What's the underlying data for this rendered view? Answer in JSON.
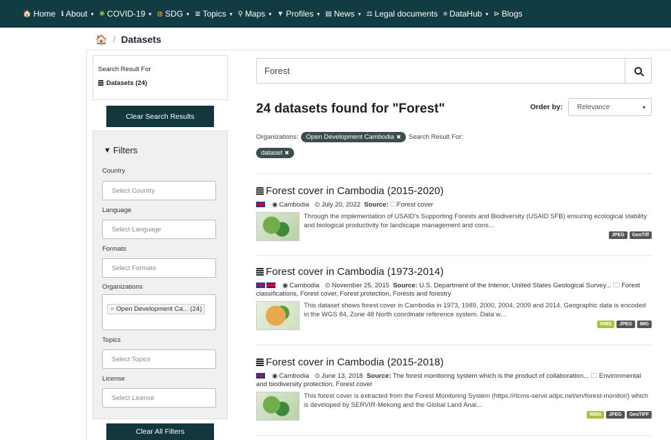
{
  "nav": {
    "items": [
      {
        "icon": "home-icon",
        "glyph": "🏠",
        "label": "Home",
        "caret": false
      },
      {
        "icon": "info-icon",
        "glyph": "ℹ",
        "label": "About",
        "caret": true
      },
      {
        "icon": "virus-icon",
        "glyph": "✺",
        "label": "COVID-19",
        "caret": true
      },
      {
        "icon": "sdg-icon",
        "glyph": "◍",
        "label": "SDG",
        "caret": true
      },
      {
        "icon": "list-icon",
        "glyph": "≣",
        "label": "Topics",
        "caret": true
      },
      {
        "icon": "map-marker-icon",
        "glyph": "⚲",
        "label": "Maps",
        "caret": true
      },
      {
        "icon": "filter-icon",
        "glyph": "▼",
        "label": "Profiles",
        "caret": true
      },
      {
        "icon": "newspaper-icon",
        "glyph": "▤",
        "label": "News",
        "caret": true
      },
      {
        "icon": "gavel-icon",
        "glyph": "⚖",
        "label": "Legal documents",
        "caret": false
      },
      {
        "icon": "database-icon",
        "glyph": "≡",
        "label": "DataHub",
        "caret": true
      },
      {
        "icon": "rss-icon",
        "glyph": "⊳",
        "label": "Blogs",
        "caret": false
      }
    ]
  },
  "breadcrumb": {
    "home_glyph": "🏠",
    "separator": "/",
    "current": "Datasets"
  },
  "result_box": {
    "title": "Search Result For",
    "datasets": "Datasets (24)"
  },
  "buttons": {
    "clear_search": "Clear Search Results",
    "clear_filters": "Clear All Filters"
  },
  "filters": {
    "title": "Filters",
    "country": {
      "label": "Country",
      "placeholder": "Select Country"
    },
    "language": {
      "label": "Language",
      "placeholder": "Select Language"
    },
    "formats": {
      "label": "Formats",
      "placeholder": "Select Formats"
    },
    "organizations": {
      "label": "Organizations",
      "chip": "Open Development Ca... (24)"
    },
    "topics": {
      "label": "Topics",
      "placeholder": "Select Topics"
    },
    "license": {
      "label": "License",
      "placeholder": "Select License"
    }
  },
  "search": {
    "value": "Forest"
  },
  "found_text": "24 datasets found for \"Forest\"",
  "order": {
    "label": "Order by:",
    "selected": "Relevance"
  },
  "facets": {
    "org_label": "Organizations:",
    "org_chip": "Open Development Cambodia",
    "result_label": "Search Result For:",
    "type_chip": "dataset"
  },
  "datasets": [
    {
      "title": "Forest cover in Cambodia (2015-2020)",
      "country": "Cambodia",
      "date": "July 20, 2022",
      "source_label": "Source:",
      "source": "Forest cover",
      "description": "Through the implementation of USAID's Supporting Forests and Biodiversity (USAID SFB) ensuring ecological stability and biological productivity for landscape management and cons...",
      "formats": [
        "JPEG",
        "GeoTiff"
      ]
    },
    {
      "title": "Forest cover in Cambodia (1973-2014)",
      "country": "Cambodia",
      "date": "November 25, 2015",
      "source_label": "Source:",
      "source": "U.S. Department of the Interior, United States Geological Survey... 🗀 Forest classifications, Forest cover, Forest protection, Forests and forestry",
      "description": "This dataset shows forest cover in Cambodia in 1973, 1989, 2000, 2004, 2009 and 2014. Geographic data is encoded in the WGS 84, Zone 48 North coordinate reference system. Data w...",
      "formats": [
        "WMS",
        "JPEG",
        "IMG"
      ]
    },
    {
      "title": "Forest cover in Cambodia (2015-2018)",
      "country": "Cambodia",
      "date": "June 13, 2018",
      "source_label": "Source:",
      "source": "The forest monitoring system which is the product of collaboration... 🗀 Environmental and biodiversity protection, Forest cover",
      "description": "This forest cover is extracted from the Forest Monitoring System (https://rlcms-servir.adpc.net/en/forest-monitor/) which is developed by SERVIR-Mekong and the Global Land Anal...",
      "formats": [
        "WMS",
        "JPEG",
        "GeoTIFF"
      ]
    }
  ]
}
